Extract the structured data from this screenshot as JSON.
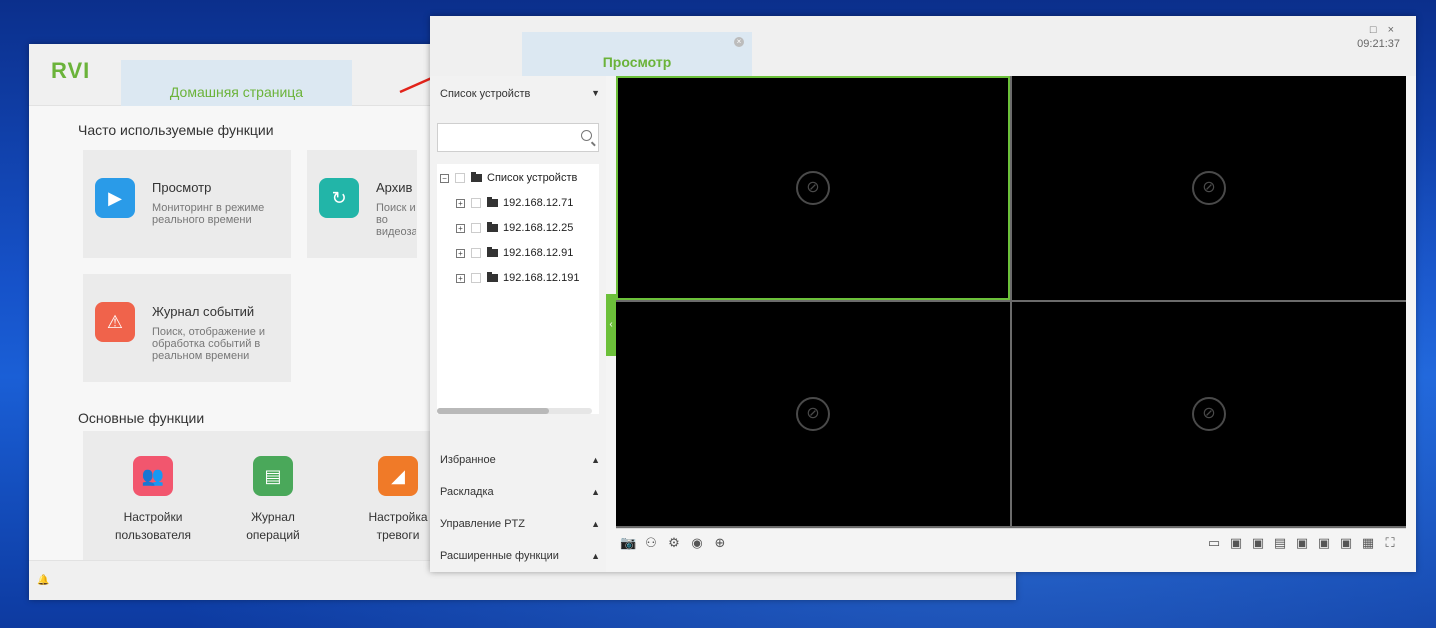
{
  "home_window": {
    "logo": "RVI",
    "tab_label": "Домашняя страница",
    "frequent_title": "Часто используемые функции",
    "tiles": [
      {
        "title": "Просмотр",
        "desc": "Мониторинг в режиме реального времени",
        "color": "#2a9be8"
      },
      {
        "title": "Архив",
        "desc": "Поиск и во видеозапи",
        "color": "#22b5a8"
      },
      {
        "title": "Журнал событий",
        "desc": "Поиск, отображение и обработка событий в реальном времени",
        "color": "#f0634b"
      }
    ],
    "basic_title": "Основные функции",
    "basic_items": [
      {
        "line1": "Настройки",
        "line2": "пользователя",
        "color": "#f2566e"
      },
      {
        "line1": "Журнал",
        "line2": "операций",
        "color": "#4aa85a"
      },
      {
        "line1": "Настройка",
        "line2": "тревоги",
        "color": "#f07a28"
      }
    ]
  },
  "preview_window": {
    "tab_label": "Просмотр",
    "tab_close": "×",
    "window_controls": "□ ×",
    "clock": "09:21:37",
    "device_panel": {
      "header": "Список устройств",
      "header_caret": "▼",
      "tree_root": "Список устройств",
      "devices": [
        "192.168.12.71",
        "192.168.12.25",
        "192.168.12.91",
        "192.168.12.191"
      ]
    },
    "sections": [
      {
        "label": "Избранное",
        "caret": "▲"
      },
      {
        "label": "Раскладка",
        "caret": "▲"
      },
      {
        "label": "Управление PTZ",
        "caret": "▲"
      },
      {
        "label": "Расширенные функции",
        "caret": "▲"
      }
    ],
    "collapse_glyph": "‹",
    "camera_glyph": "⊘",
    "toolbar_left": [
      "📷",
      "⚇",
      "⚙",
      "◉",
      "⊕"
    ],
    "toolbar_right": [
      "▭",
      "▣",
      "▣",
      "▤",
      "▣",
      "▣",
      "▣",
      "▦",
      "⛶"
    ],
    "accent_color": "#6cc03a"
  }
}
